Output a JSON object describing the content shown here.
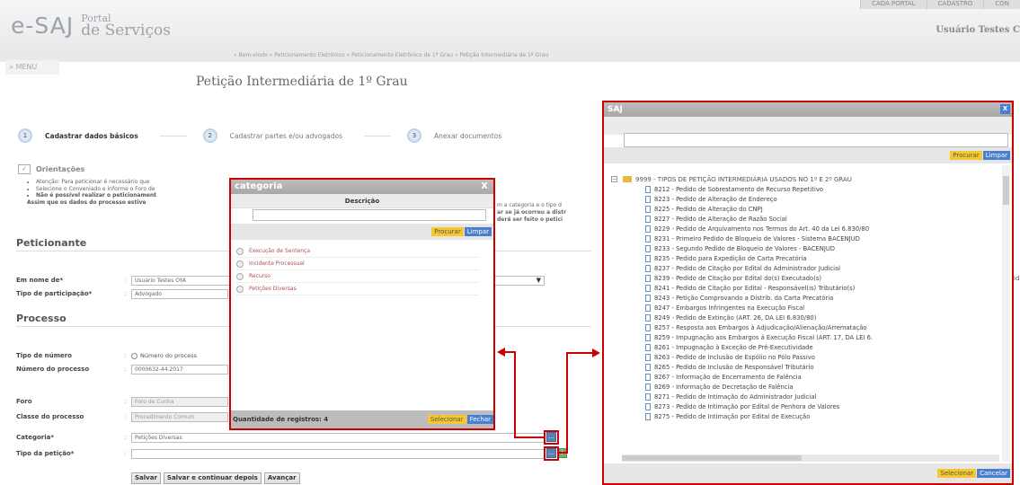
{
  "header": {
    "logo_main": "e-SAJ",
    "logo_sub1": "Portal",
    "logo_sub2": "de Serviços",
    "top_links": [
      "CADA PORTAL",
      "CADASTRO",
      "CON"
    ],
    "user": "Usuário Testes C",
    "breadcrumb": "» Bem-vindo » Peticionamento Eletrônico » Peticionamento Eletrônico de 1º Grau » Petição Intermediária de 1º Grau",
    "menu": "» MENU"
  },
  "page_title": "Petição Intermediária de 1º Grau",
  "steps": [
    {
      "num": "1",
      "label": "Cadastrar dados básicos"
    },
    {
      "num": "2",
      "label": "Cadastrar partes e/ou advogados"
    },
    {
      "num": "3",
      "label": "Anexar documentos"
    }
  ],
  "guidance": {
    "title": "Orientações",
    "lines": [
      "Atenção: Para peticionar é necessário que",
      "Selecione o Conveniado e informe o Foro de",
      "Não é possível realizar o peticionament",
      "Assim que os dados do processo estive"
    ],
    "right_1": "m a categoria e o tipo d",
    "right_2": "ar se já ocorreu a distr",
    "right_3": "derá ser feito o petici"
  },
  "peticionante": {
    "section_title": "Peticionante",
    "em_nome_label": "Em nome de*",
    "em_nome_value": "Usuario Testes OYA",
    "tipo_part_label": "Tipo de participação*",
    "tipo_part_value": "Advogado"
  },
  "processo": {
    "section_title": "Processo",
    "tipo_numero_label": "Tipo de número",
    "tipo_numero_value": "Número do process",
    "numero_label": "Número do processo",
    "numero_value": "0000632-44.2017",
    "foro_label": "Foro",
    "foro_value": "Foro de Cunha",
    "classe_label": "Classe do processo",
    "classe_value": "Procedimento Comum",
    "categoria_label": "Categoria*",
    "categoria_value": "Petições Diversas",
    "tipo_peticao_label": "Tipo da petição*",
    "tipo_peticao_value": ""
  },
  "buttons": {
    "salvar": "Salvar",
    "salvar_continuar": "Salvar e continuar depois",
    "avancar": "Avançar"
  },
  "categoria_dialog": {
    "title": "categoria",
    "close": "X",
    "column": "Descrição",
    "procurar": "Procurar",
    "limpar": "Limpar",
    "items": [
      "Execução de Sentença",
      "Incidente Processual",
      "Recurso",
      "Petições Diversas"
    ],
    "quantity": "Quantidade de registros: 4",
    "selecionar": "Selecionar",
    "fechar": "Fechar"
  },
  "saj_dialog": {
    "title": "SAJ",
    "close": "X",
    "procurar": "Procurar",
    "limpar": "Limpar",
    "root": "9999 - TIPOS DE PETIÇÃO INTERMEDIÁRIA USADOS NO 1º E 2º GRAU",
    "items": [
      "8212 - Pedido de Sobrestamento de Recurso Repetitivo",
      "8223 - Pedido de Alteração de Endereço",
      "8225 - Pedido de Alteração do CNPJ",
      "8227 - Pedido de Alteração de Razão Social",
      "8229 - Pedido de Arquivamento nos Termos do Art. 40 da Lei 6.830/80",
      "8231 - Primeiro Pedido de Bloqueio de Valores - Sistema BACENJUD",
      "8233 - Segundo Pedido de Bloqueio de Valores - BACENJUD",
      "8235 - Pedido para Expedição de Carta Precatória",
      "8237 - Pedido de Citação por Edital do Administrador Judicial",
      "8239 - Pedido de Citação por Edital do(s) Executado(s)",
      "8241 - Pedido de Citação por Edital - Responsável(is) Tributário(s)",
      "8243 - Petição Comprovando a Distrib. da Carta Precatória",
      "8247 - Embargos Infringentes na Execução Fiscal",
      "8249 - Pedido de Extinção (ART. 26, DA LEI 6.830/80)",
      "8257 - Resposta aos Embargos à Adjudicação/Alienação/Arrematação",
      "8259 - Impugnação aos Embargos à Execução Fiscal (ART. 17, DA LEI 6.",
      "8261 - Impugnação à Exceção de Pré-Executividade",
      "8263 - Pedido de Inclusão de Espólio no Pólo Passivo",
      "8265 - Pedido de Inclusão de Responsável Tributário",
      "8267 - Informação de Encerramento de Falência",
      "8269 - Informação de Decretação de Falência",
      "8271 - Pedido de Intimação do Administrador Judicial",
      "8273 - Pedido de Intimação por Edital de Penhora de Valores",
      "8275 - Pedido de Intimação por Edital de Execução"
    ],
    "selecionar": "Selecionar",
    "cancelar": "Cancelar"
  },
  "right_edge_text": "id"
}
